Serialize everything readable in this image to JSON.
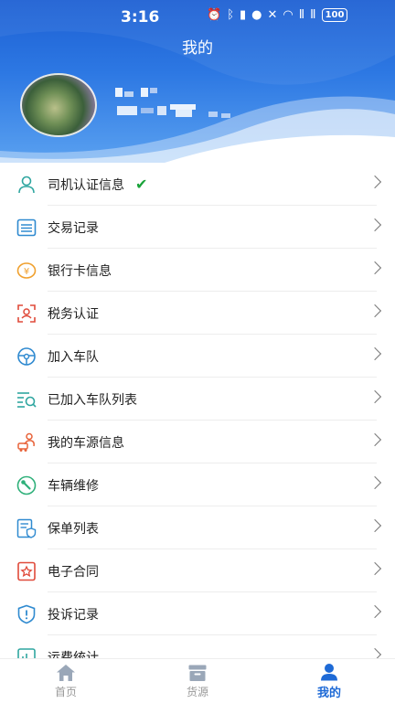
{
  "status_bar": {
    "time": "3:16",
    "signal_1": "Ⅱ",
    "signal_2": "Ⅱ",
    "battery": "100"
  },
  "header": {
    "title": "我的"
  },
  "profile": {
    "name_masked": "",
    "phone_masked": ""
  },
  "menu": {
    "items": [
      {
        "label": "司机认证信息",
        "icon": "person-icon",
        "color": "#2fa6a0",
        "verified": "✔"
      },
      {
        "label": "交易记录",
        "icon": "list-icon",
        "color": "#2f8ad0"
      },
      {
        "label": "银行卡信息",
        "icon": "yuan-coin-icon",
        "color": "#f0a02e"
      },
      {
        "label": "税务认证",
        "icon": "id-scan-icon",
        "color": "#e04a3a"
      },
      {
        "label": "加入车队",
        "icon": "steering-wheel-icon",
        "color": "#2f8ad0"
      },
      {
        "label": "已加入车队列表",
        "icon": "list-search-icon",
        "color": "#2fa6a0"
      },
      {
        "label": "我的车源信息",
        "icon": "driver-truck-icon",
        "color": "#e8633a"
      },
      {
        "label": "车辆维修",
        "icon": "wrench-icon",
        "color": "#2fb07a"
      },
      {
        "label": "保单列表",
        "icon": "policy-shield-icon",
        "color": "#2f8ad0"
      },
      {
        "label": "电子合同",
        "icon": "contract-stamp-icon",
        "color": "#e04a3a"
      },
      {
        "label": "投诉记录",
        "icon": "complaint-shield-icon",
        "color": "#2f8ad0"
      },
      {
        "label": "运费统计",
        "icon": "chart-icon",
        "color": "#2fa6a0"
      }
    ]
  },
  "tabbar": {
    "tabs": [
      {
        "label": "首页",
        "icon": "home-icon",
        "active": false
      },
      {
        "label": "货源",
        "icon": "cargo-box-icon",
        "active": false
      },
      {
        "label": "我的",
        "icon": "profile-icon",
        "active": true
      }
    ]
  },
  "colors": {
    "header_blue": "#1c5fd3",
    "accent": "#1e6ad6",
    "verified_green": "#1aa33a"
  }
}
